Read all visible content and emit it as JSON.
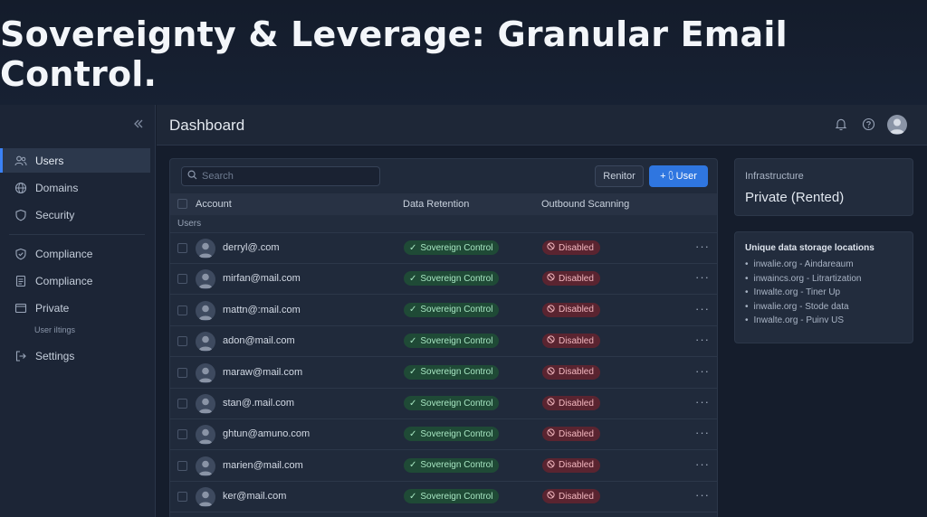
{
  "banner": {
    "title": "Sovereignty & Leverage: Granular Email Control."
  },
  "sidebar": {
    "items": [
      {
        "label": "Users",
        "icon": "users-icon"
      },
      {
        "label": "Domains",
        "icon": "globe-icon"
      },
      {
        "label": "Security",
        "icon": "shield-icon"
      },
      {
        "label": "Compliance",
        "icon": "shield-check-icon"
      },
      {
        "label": "Compliance",
        "icon": "document-icon"
      },
      {
        "label": "Private",
        "icon": "window-icon"
      },
      {
        "label": "Settings",
        "icon": "logout-icon"
      }
    ],
    "sub_label": "User iItings"
  },
  "header": {
    "title": "Dashboard"
  },
  "toolbar": {
    "search_placeholder": "Search",
    "renitor_label": "Renitor",
    "add_user_label": "+ ⩇ User"
  },
  "table": {
    "columns": [
      "Account",
      "Data Retention",
      "Outbound Scanning"
    ],
    "group_label": "Users",
    "rows": [
      {
        "email": "derryl@.com",
        "retention": "Sovereign Control",
        "scanning": "Disabled"
      },
      {
        "email": "mirfan@mail.com",
        "retention": "Sovereign Control",
        "scanning": "Disabled"
      },
      {
        "email": "mattn@:mail.com",
        "retention": "Sovereign Control",
        "scanning": "Disabled"
      },
      {
        "email": "adon@mail.com",
        "retention": "Sovereign Control",
        "scanning": "Disabled"
      },
      {
        "email": "maraw@mail.com",
        "retention": "Sovereign Control",
        "scanning": "Disabled"
      },
      {
        "email": "stan@.mail.com",
        "retention": "Sovereign Control",
        "scanning": "Disabled"
      },
      {
        "email": "ghtun@amuno.com",
        "retention": "Sovereign Control",
        "scanning": "Disabled"
      },
      {
        "email": "marien@mail.com",
        "retention": "Sovereign Control",
        "scanning": "Disabled"
      },
      {
        "email": "ker@mail.com",
        "retention": "Sovereign Control",
        "scanning": "Disabled"
      }
    ]
  },
  "infrastructure": {
    "label": "Infrastructure",
    "value": "Private (Rented)"
  },
  "locations": {
    "title": "Unique data storage locations",
    "items": [
      "inwalie.org - Aindareaum",
      "inwaincs.org - Litrartization",
      "Inwalte.org - Tiner Up",
      "inwalie.org - Stode data",
      "Inwalte.org - Puinv US"
    ]
  },
  "colors": {
    "accent": "#2f76e0",
    "success": "#1f4a36",
    "danger": "#5a2430",
    "background": "#151d2c"
  }
}
